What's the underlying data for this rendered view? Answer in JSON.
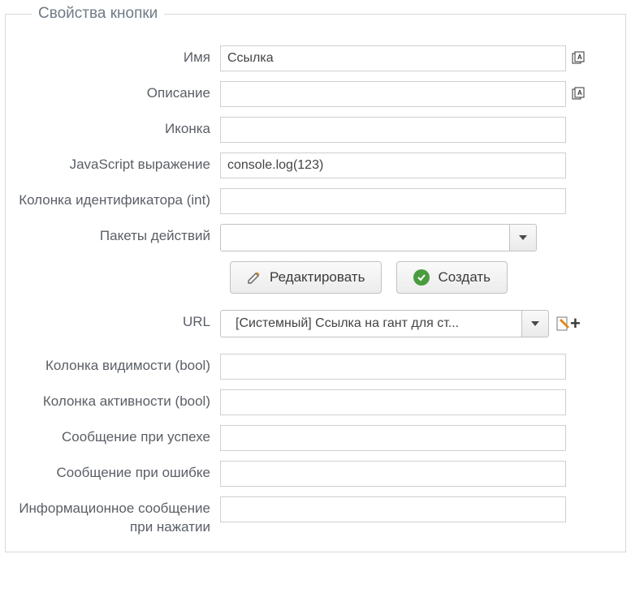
{
  "legend": "Свойства кнопки",
  "labels": {
    "name": "Имя",
    "description": "Описание",
    "icon": "Иконка",
    "jsExpression": "JavaScript выражение",
    "idColumn": "Колонка идентификатора (int)",
    "actionPackages": "Пакеты действий",
    "url": "URL",
    "visibilityColumn": "Колонка видимости (bool)",
    "activityColumn": "Колонка активности (bool)",
    "successMessage": "Сообщение при успехе",
    "errorMessage": "Сообщение при ошибке",
    "infoMessageOnClick": "Информационное сообщение при нажатии"
  },
  "values": {
    "name": "Ссылка",
    "description": "",
    "icon": "",
    "jsExpression": "console.log(123)",
    "idColumn": "",
    "actionPackages": "",
    "url": "[Системный] Ссылка на гант для ст...",
    "visibilityColumn": "",
    "activityColumn": "",
    "successMessage": "",
    "errorMessage": "",
    "infoMessageOnClick": ""
  },
  "buttons": {
    "edit": "Редактировать",
    "create": "Создать"
  }
}
